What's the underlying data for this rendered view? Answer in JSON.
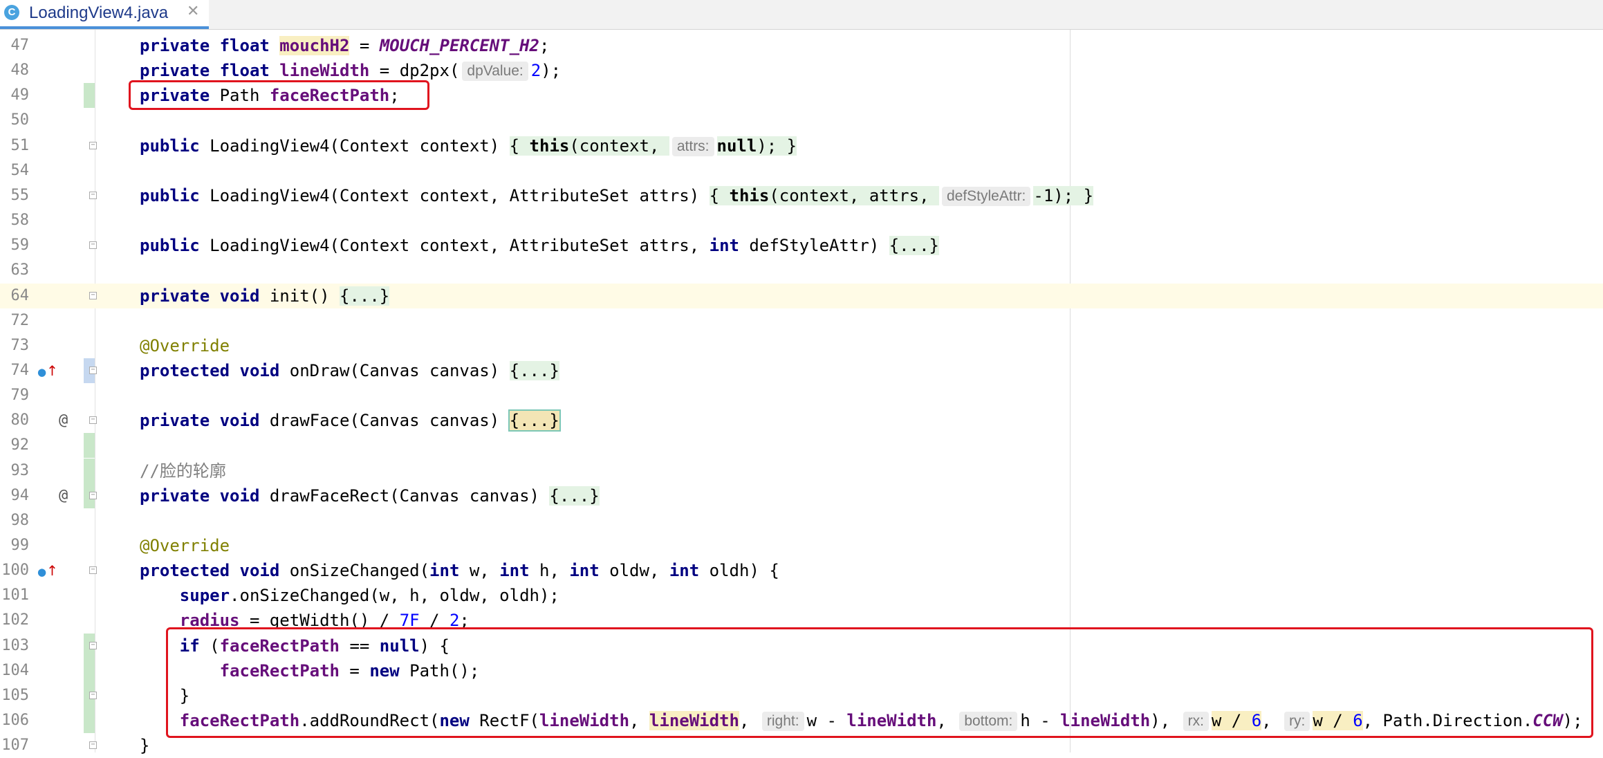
{
  "tab": {
    "icon_letter": "C",
    "filename": "LoadingView4.java",
    "close": "✕"
  },
  "lines": [
    {
      "n": "47",
      "segs": [
        {
          "t": "private float ",
          "c": "kw"
        },
        {
          "t": "mouchH2",
          "c": "fd yl"
        },
        {
          "t": " = "
        },
        {
          "t": "MOUCH_PERCENT_H2",
          "c": "cst"
        },
        {
          "t": ";"
        }
      ]
    },
    {
      "n": "48",
      "segs": [
        {
          "t": "private float ",
          "c": "kw"
        },
        {
          "t": "lineWidth",
          "c": "fd"
        },
        {
          "t": " = dp2px("
        },
        {
          "t": "dpValue:",
          "c": "hint"
        },
        {
          "t": "2",
          "c": "num"
        },
        {
          "t": ");"
        }
      ]
    },
    {
      "n": "49",
      "chg": "green",
      "segs": [
        {
          "t": "private ",
          "c": "kw"
        },
        {
          "t": "Path "
        },
        {
          "t": "faceRectPath",
          "c": "fd"
        },
        {
          "t": ";"
        }
      ]
    },
    {
      "n": "50",
      "segs": []
    },
    {
      "n": "51",
      "fold": true,
      "segs": [
        {
          "t": "public ",
          "c": "kw"
        },
        {
          "t": "LoadingView4(Context context) "
        },
        {
          "t": "{ ",
          "c": "fb"
        },
        {
          "t": "this",
          "c": "kw fb"
        },
        {
          "t": "(context, ",
          "c": "fb"
        },
        {
          "t": "attrs:",
          "c": "hint"
        },
        {
          "t": "null",
          "c": "kw fb"
        },
        {
          "t": "); }",
          "c": "fb"
        }
      ]
    },
    {
      "n": "54",
      "segs": []
    },
    {
      "n": "55",
      "fold": true,
      "segs": [
        {
          "t": "public ",
          "c": "kw"
        },
        {
          "t": "LoadingView4(Context context, AttributeSet attrs) "
        },
        {
          "t": "{ ",
          "c": "fb"
        },
        {
          "t": "this",
          "c": "kw fb"
        },
        {
          "t": "(context, attrs, ",
          "c": "fb"
        },
        {
          "t": "defStyleAttr:",
          "c": "hint"
        },
        {
          "t": "-",
          "c": "fb"
        },
        {
          "t": "1",
          "c": "num fb"
        },
        {
          "t": "); }",
          "c": "fb"
        }
      ]
    },
    {
      "n": "58",
      "segs": []
    },
    {
      "n": "59",
      "fold": true,
      "segs": [
        {
          "t": "public ",
          "c": "kw"
        },
        {
          "t": "LoadingView4(Context context, AttributeSet attrs, "
        },
        {
          "t": "int ",
          "c": "kw"
        },
        {
          "t": "defStyleAttr) "
        },
        {
          "t": "{...}",
          "c": "fb"
        }
      ]
    },
    {
      "n": "63",
      "segs": []
    },
    {
      "n": "64",
      "fold": true,
      "hl": true,
      "segs": [
        {
          "t": "private void ",
          "c": "kw"
        },
        {
          "t": "init() "
        },
        {
          "t": "{...}",
          "c": "fb"
        }
      ]
    },
    {
      "n": "72",
      "segs": []
    },
    {
      "n": "73",
      "segs": [
        {
          "t": "@Override",
          "c": "ann"
        }
      ]
    },
    {
      "n": "74",
      "fold": true,
      "chg": "blue",
      "ov": true,
      "segs": [
        {
          "t": "protected void ",
          "c": "kw"
        },
        {
          "t": "onDraw(Canvas canvas) "
        },
        {
          "t": "{...}",
          "c": "fb"
        }
      ]
    },
    {
      "n": "79",
      "segs": []
    },
    {
      "n": "80",
      "fold": true,
      "at": true,
      "segs": [
        {
          "t": "private void ",
          "c": "kw"
        },
        {
          "t": "drawFace(Canvas canvas) "
        },
        {
          "t": "{...}",
          "c": "fb sel"
        }
      ]
    },
    {
      "n": "92",
      "chg": "green",
      "segs": []
    },
    {
      "n": "93",
      "chg": "green",
      "segs": [
        {
          "t": "//脸的轮廓",
          "c": "cm"
        }
      ]
    },
    {
      "n": "94",
      "fold": true,
      "chg": "green",
      "at": true,
      "segs": [
        {
          "t": "private void ",
          "c": "kw"
        },
        {
          "t": "drawFaceRect(Canvas canvas) "
        },
        {
          "t": "{...}",
          "c": "fb"
        }
      ]
    },
    {
      "n": "98",
      "segs": []
    },
    {
      "n": "99",
      "segs": [
        {
          "t": "@Override",
          "c": "ann"
        }
      ]
    },
    {
      "n": "100",
      "fold": true,
      "ov": true,
      "segs": [
        {
          "t": "protected void ",
          "c": "kw"
        },
        {
          "t": "onSizeChanged("
        },
        {
          "t": "int ",
          "c": "kw"
        },
        {
          "t": "w, "
        },
        {
          "t": "int ",
          "c": "kw"
        },
        {
          "t": "h, "
        },
        {
          "t": "int ",
          "c": "kw"
        },
        {
          "t": "oldw, "
        },
        {
          "t": "int ",
          "c": "kw"
        },
        {
          "t": "oldh) {"
        }
      ]
    },
    {
      "n": "101",
      "segs": [
        {
          "t": "    "
        },
        {
          "t": "super",
          "c": "kw"
        },
        {
          "t": ".onSizeChanged(w, h, oldw, oldh);"
        }
      ]
    },
    {
      "n": "102",
      "segs": [
        {
          "t": "    "
        },
        {
          "t": "radius",
          "c": "fd"
        },
        {
          "t": " = getWidth() / "
        },
        {
          "t": "7F",
          "c": "num"
        },
        {
          "t": " / "
        },
        {
          "t": "2",
          "c": "num"
        },
        {
          "t": ";"
        }
      ]
    },
    {
      "n": "103",
      "fold": true,
      "chg": "green",
      "segs": [
        {
          "t": "    "
        },
        {
          "t": "if ",
          "c": "kw"
        },
        {
          "t": "("
        },
        {
          "t": "faceRectPath",
          "c": "fd"
        },
        {
          "t": " == "
        },
        {
          "t": "null",
          "c": "kw"
        },
        {
          "t": ") {"
        }
      ]
    },
    {
      "n": "104",
      "chg": "green",
      "segs": [
        {
          "t": "        "
        },
        {
          "t": "faceRectPath",
          "c": "fd"
        },
        {
          "t": " = "
        },
        {
          "t": "new ",
          "c": "kw"
        },
        {
          "t": "Path();"
        }
      ]
    },
    {
      "n": "105",
      "fold": true,
      "chg": "green",
      "segs": [
        {
          "t": "    }"
        }
      ]
    },
    {
      "n": "106",
      "chg": "green",
      "segs": [
        {
          "t": "    "
        },
        {
          "t": "faceRectPath",
          "c": "fd"
        },
        {
          "t": ".addRoundRect("
        },
        {
          "t": "new ",
          "c": "kw"
        },
        {
          "t": "RectF("
        },
        {
          "t": "lineWidth",
          "c": "fd"
        },
        {
          "t": ", "
        },
        {
          "t": "lineWidth",
          "c": "fd yl"
        },
        {
          "t": ", "
        },
        {
          "t": "right:",
          "c": "hint"
        },
        {
          "t": "w - "
        },
        {
          "t": "lineWidth",
          "c": "fd"
        },
        {
          "t": ", "
        },
        {
          "t": "bottom:",
          "c": "hint"
        },
        {
          "t": "h - "
        },
        {
          "t": "lineWidth",
          "c": "fd"
        },
        {
          "t": "), "
        },
        {
          "t": "rx:",
          "c": "hint"
        },
        {
          "t": "w / ",
          "c": "yl"
        },
        {
          "t": "6",
          "c": "num yl"
        },
        {
          "t": ", "
        },
        {
          "t": "ry:",
          "c": "hint"
        },
        {
          "t": "w / ",
          "c": "yl"
        },
        {
          "t": "6",
          "c": "num yl"
        },
        {
          "t": ", Path.Direction."
        },
        {
          "t": "CCW",
          "c": "cst"
        },
        {
          "t": ");"
        }
      ]
    },
    {
      "n": "107",
      "fold": true,
      "segs": [
        {
          "t": "}"
        }
      ]
    }
  ]
}
